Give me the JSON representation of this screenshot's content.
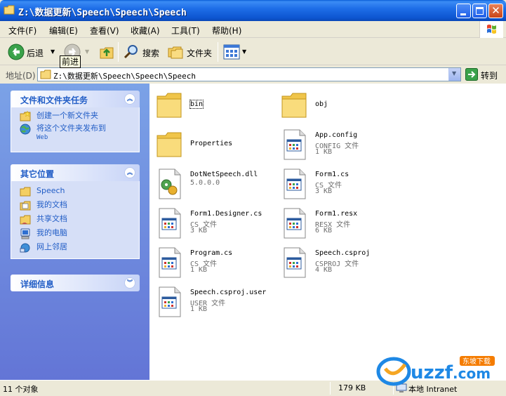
{
  "window": {
    "title": "Z:\\数据更新\\Speech\\Speech\\Speech"
  },
  "menu": {
    "items": [
      "文件(F)",
      "编辑(E)",
      "查看(V)",
      "收藏(A)",
      "工具(T)",
      "帮助(H)"
    ]
  },
  "toolbar": {
    "back_label": "后退",
    "search_label": "搜索",
    "folders_label": "文件夹",
    "tooltip": "前进"
  },
  "address": {
    "label": "地址(D)",
    "path": "Z:\\数据更新\\Speech\\Speech\\Speech",
    "go_label": "转到"
  },
  "tasks": {
    "file_tasks": {
      "title": "文件和文件夹任务",
      "items": [
        {
          "label": "创建一个新文件夹",
          "icon": "new-folder-icon"
        },
        {
          "label": "将这个文件夹发布到",
          "sub": "Web",
          "icon": "publish-web-icon"
        }
      ]
    },
    "other_places": {
      "title": "其它位置",
      "items": [
        {
          "label": "Speech",
          "icon": "folder-icon"
        },
        {
          "label": "我的文档",
          "icon": "my-documents-icon"
        },
        {
          "label": "共享文档",
          "icon": "shared-documents-icon"
        },
        {
          "label": "我的电脑",
          "icon": "my-computer-icon"
        },
        {
          "label": "网上邻居",
          "icon": "network-places-icon"
        }
      ]
    },
    "details": {
      "title": "详细信息"
    }
  },
  "files": [
    {
      "name": "bin",
      "kind": "folder"
    },
    {
      "name": "obj",
      "kind": "folder"
    },
    {
      "name": "Properties",
      "kind": "folder"
    },
    {
      "name": "App.config",
      "type": "CONFIG 文件",
      "size": "1 KB",
      "kind": "doc"
    },
    {
      "name": "DotNetSpeech.dll",
      "type": "5.0.0.0",
      "kind": "dll"
    },
    {
      "name": "Form1.cs",
      "type": "CS 文件",
      "size": "3 KB",
      "kind": "doc"
    },
    {
      "name": "Form1.Designer.cs",
      "type": "CS 文件",
      "size": "3 KB",
      "kind": "doc"
    },
    {
      "name": "Form1.resx",
      "type": "RESX 文件",
      "size": "6 KB",
      "kind": "doc"
    },
    {
      "name": "Program.cs",
      "type": "CS 文件",
      "size": "1 KB",
      "kind": "doc"
    },
    {
      "name": "Speech.csproj",
      "type": "CSPROJ 文件",
      "size": "4 KB",
      "kind": "doc"
    },
    {
      "name": "Speech.csproj.user",
      "type": "USER 文件",
      "size": "1 KB",
      "kind": "doc"
    }
  ],
  "status": {
    "count": "11 个对象",
    "size": "179 KB",
    "zone": "本地 Intranet"
  },
  "watermark": {
    "brand": "uzzf",
    "domain": ".com",
    "tag": "东坡下载"
  }
}
